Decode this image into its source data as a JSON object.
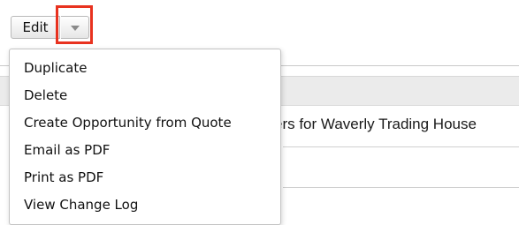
{
  "toolbar": {
    "edit_label": "Edit"
  },
  "record": {
    "name_fragment": "ers for Waverly Trading House"
  },
  "menu": {
    "items": [
      "Duplicate",
      "Delete",
      "Create Opportunity from Quote",
      "Email as PDF",
      "Print as PDF",
      "View Change Log"
    ]
  },
  "colors": {
    "highlight": "#e8321f",
    "header_band": "#ebebeb"
  },
  "icons": {
    "caret": "chevron-down-icon"
  }
}
